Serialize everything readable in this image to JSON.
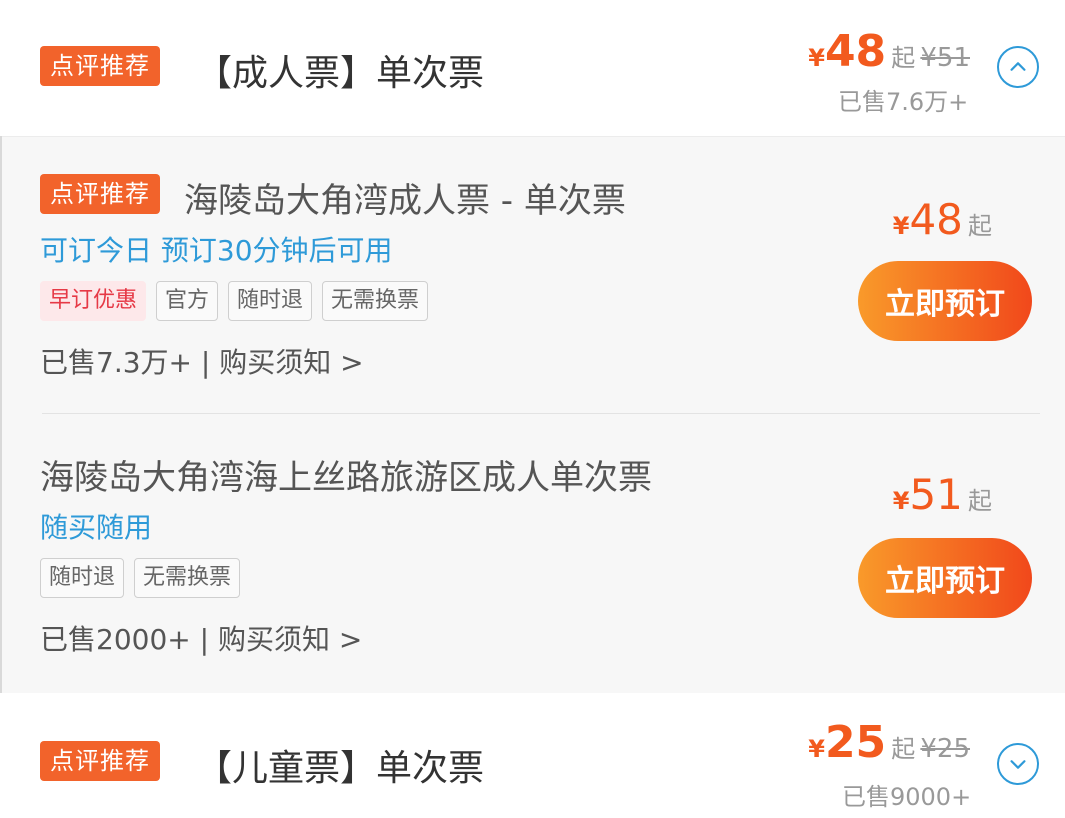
{
  "adult_section": {
    "badge": "点评推荐",
    "title": "【成人票】单次票",
    "currency": "¥",
    "price": "48",
    "from": "起",
    "original_price": "¥51",
    "sold": "已售7.6万+",
    "toggle_icon": "chevron-up-icon"
  },
  "items": [
    {
      "badge": "点评推荐",
      "title": "海陵岛大角湾成人票 - 单次票",
      "availability": "可订今日 预订30分钟后可用",
      "tags": [
        "早订优惠",
        "官方",
        "随时退",
        "无需换票"
      ],
      "sold_info": "已售7.3万+ | 购买须知 >",
      "currency": "¥",
      "price": "48",
      "from": "起",
      "button": "立即预订"
    },
    {
      "title": "海陵岛大角湾海上丝路旅游区成人单次票",
      "availability": "随买随用",
      "tags": [
        "随时退",
        "无需换票"
      ],
      "sold_info": "已售2000+ | 购买须知 >",
      "currency": "¥",
      "price": "51",
      "from": "起",
      "button": "立即预订"
    }
  ],
  "child_section": {
    "badge": "点评推荐",
    "title": "【儿童票】单次票",
    "currency": "¥",
    "price": "25",
    "from": "起",
    "original_price": "¥25",
    "sold": "已售9000+",
    "toggle_icon": "chevron-down-icon"
  },
  "colors": {
    "accent_orange": "#f25a1e",
    "badge_orange": "#f2632b",
    "link_blue": "#2e9ad8",
    "promo_red": "#e63946"
  }
}
